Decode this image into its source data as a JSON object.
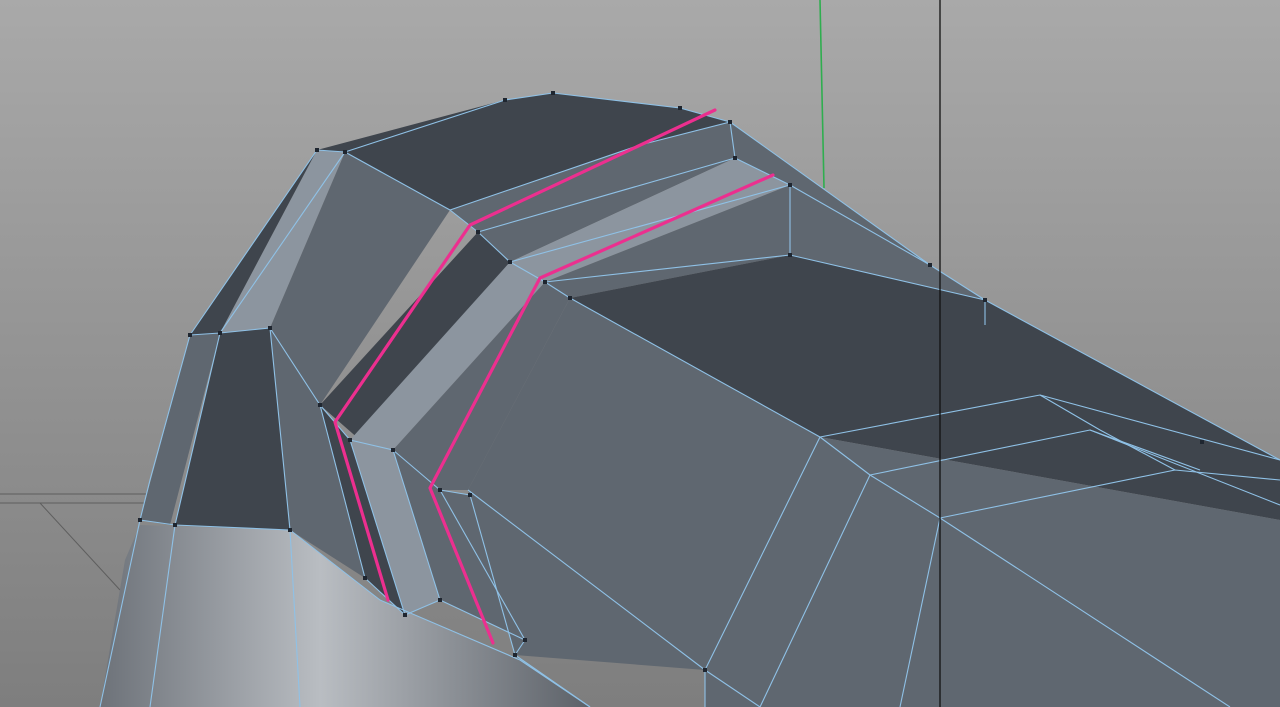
{
  "viewport": {
    "view": "3d-perspective",
    "display_mode": "gouraud-shading-with-wireframe",
    "colors": {
      "background_top": "#a9a9a9",
      "background_bottom": "#7e7e7e",
      "mesh_dark": "#3f454d",
      "mesh_mid": "#5f6770",
      "mesh_light": "#8c959f",
      "wire": "#8fc1e6",
      "vertex": "#1f2630",
      "selected_edges": "#ec2f8f",
      "y_axis": "#2fae4f",
      "guide_line": "#111111",
      "floor_grid": "#5e5e5e"
    }
  },
  "mesh": {
    "object": "polygon-object",
    "mode": "edge-selection",
    "selected_edge_loops": 2
  },
  "icons": {
    "y_axis": "y-axis-line",
    "guide": "vertical-guide-line"
  }
}
